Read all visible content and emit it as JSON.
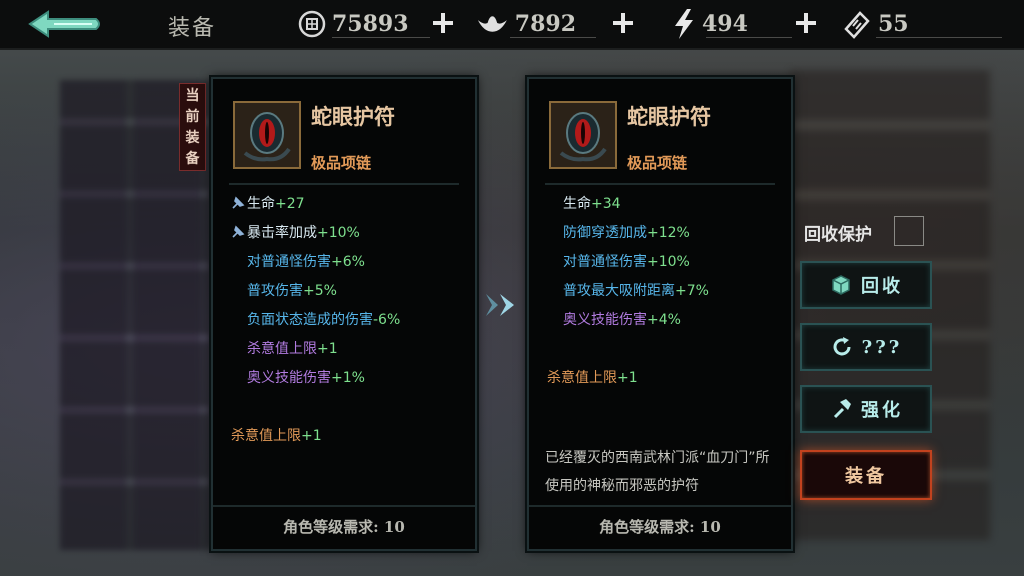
{
  "topbar": {
    "title": "装备",
    "resources": [
      {
        "icon": "coin-icon",
        "value": "75893"
      },
      {
        "icon": "silver-ingot-icon",
        "value": "7892"
      },
      {
        "icon": "lightning-icon",
        "value": "494"
      },
      {
        "icon": "ticket-icon",
        "value": "55"
      }
    ]
  },
  "current_tag": "当前装备",
  "left_item": {
    "name": "蛇眼护符",
    "quality": "极品项链",
    "stats": [
      {
        "name": "生命",
        "value": "+27",
        "pinned": true,
        "color": "#b9e8c9"
      },
      {
        "name": "暴击率加成",
        "value": "+10%",
        "pinned": true,
        "color": "#b9e8c9"
      },
      {
        "name": "对普通怪伤害",
        "value": "+6%",
        "pinned": false,
        "color": "#57b6ea"
      },
      {
        "name": "普攻伤害",
        "value": "+5%",
        "pinned": false,
        "color": "#57b6ea"
      },
      {
        "name": "负面状态造成的伤害",
        "value": "-6%",
        "pinned": false,
        "color": "#57b6ea"
      },
      {
        "name": "杀意值上限",
        "value": "+1",
        "pinned": false,
        "color": "#b27ce0"
      },
      {
        "name": "奥义技能伤害",
        "value": "+1%",
        "pinned": false,
        "color": "#b27ce0"
      }
    ],
    "special": {
      "name": "杀意值上限",
      "value": "+1"
    },
    "requirement": "角色等级需求: 10"
  },
  "right_item": {
    "name": "蛇眼护符",
    "quality": "极品项链",
    "stats": [
      {
        "name": "生命",
        "value": "+34",
        "color": "#b9e8c9"
      },
      {
        "name": "防御穿透加成",
        "value": "+12%",
        "color": "#57b6ea"
      },
      {
        "name": "对普通怪伤害",
        "value": "+10%",
        "color": "#57b6ea"
      },
      {
        "name": "普攻最大吸附距离",
        "value": "+7%",
        "color": "#57b6ea"
      },
      {
        "name": "奥义技能伤害",
        "value": "+4%",
        "color": "#b27ce0"
      }
    ],
    "special": {
      "name": "杀意值上限",
      "value": "+1"
    },
    "description": "已经覆灭的西南武林门派“血刀门”所使用的神秘而邪恶的护符",
    "requirement": "角色等级需求: 10"
  },
  "actions": {
    "protect_label": "回收保护",
    "recycle_label": "回收",
    "unknown_label": "???",
    "enhance_label": "强化",
    "equip_label": "装备"
  },
  "colors": {
    "green_value": "#7ee08e",
    "special_name": "#e29a58"
  }
}
